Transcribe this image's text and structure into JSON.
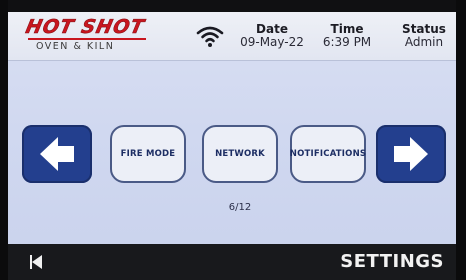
{
  "header": {
    "logo_main": "HOT SHOT",
    "logo_sub": "OVEN & KILN",
    "date_label": "Date",
    "date_value": "09-May-22",
    "time_label": "Time",
    "time_value": "6:39 PM",
    "status_label": "Status",
    "status_value": "Admin",
    "icons": {
      "wifi": "wifi-icon"
    }
  },
  "main": {
    "buttons": [
      {
        "label": "FIRE MODE"
      },
      {
        "label": "NETWORK"
      },
      {
        "label": "NOTIFICATIONS"
      }
    ],
    "page_indicator": "6/12",
    "icons": {
      "prev": "arrow-left-icon",
      "next": "arrow-right-icon"
    }
  },
  "footer": {
    "title": "SETTINGS",
    "icons": {
      "back": "back-triangle-icon"
    }
  },
  "colors": {
    "brand_red": "#c8161e",
    "nav_blue": "#233f8e",
    "button_border": "#4a5a86",
    "footer_bg": "#18191c",
    "screen_bg": "#d3dbf0"
  }
}
